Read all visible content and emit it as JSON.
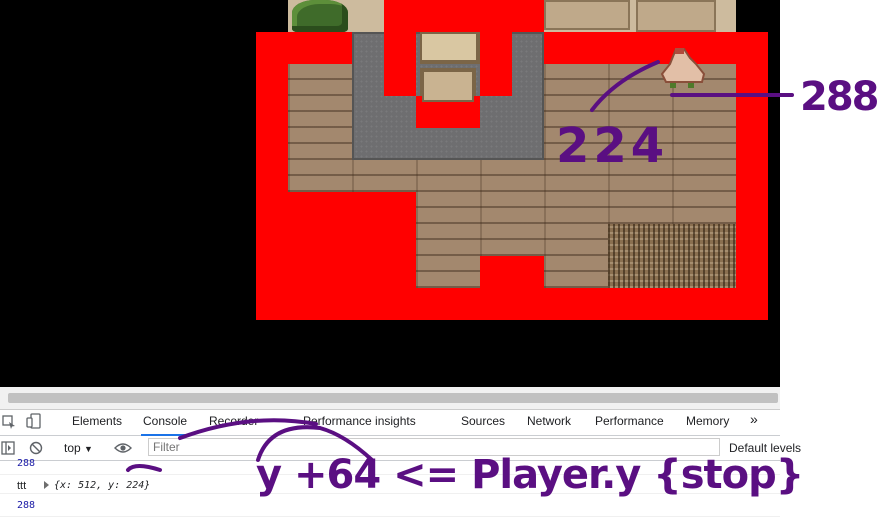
{
  "game": {
    "background": "#000000",
    "highlight_color": "#ff0000"
  },
  "devtools": {
    "tabs": [
      {
        "label": "Elements"
      },
      {
        "label": "Console"
      },
      {
        "label": "Recorder"
      },
      {
        "label": "Performance insights"
      },
      {
        "label": "Sources"
      },
      {
        "label": "Network"
      },
      {
        "label": "Performance"
      },
      {
        "label": "Memory"
      }
    ],
    "more_tabs": "»",
    "active_tab": "Console",
    "context": "top",
    "filter_placeholder": "Filter",
    "levels_label": "Default levels",
    "console_lines": [
      {
        "text": "288"
      },
      {
        "label": "ttt",
        "value": "{x: 512, y: 224}"
      },
      {
        "text": "288"
      }
    ]
  },
  "annotations": {
    "color": "#5a0f82",
    "value_x": "288",
    "value_y": "224",
    "formula": "y +64 <= Player.y {stop}"
  }
}
